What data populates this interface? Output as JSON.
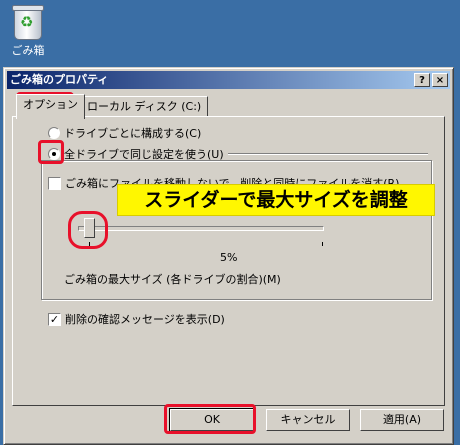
{
  "desktop": {
    "icon_label": "ごみ箱",
    "icon": "recycle-bin-icon"
  },
  "window": {
    "title": "ごみ箱のプロパティ",
    "help_label": "?",
    "close_label": "×",
    "tabs": [
      {
        "label": "オプション",
        "active": true
      },
      {
        "label": "ローカル ディスク (C:)",
        "active": false
      }
    ]
  },
  "options": {
    "radio_each_drive": {
      "label": "ドライブごとに構成する(C)",
      "selected": false
    },
    "radio_all_drives": {
      "label": "全ドライブで同じ設定を使う(U)",
      "selected": true
    },
    "checkbox_delete_immediately": {
      "label": "ごみ箱にファイルを移動しないで、削除と同時にファイルを消す(R)",
      "checked": false
    },
    "slider": {
      "value_label": "5%",
      "value_percent": 5,
      "caption": "ごみ箱の最大サイズ (各ドライブの割合)(M)"
    },
    "checkbox_confirm": {
      "label": "削除の確認メッセージを表示(D)",
      "checked": true
    }
  },
  "buttons": {
    "ok": "OK",
    "cancel": "キャンセル",
    "apply": "適用(A)"
  },
  "annotation": {
    "callout_text": "スライダーで最大サイズを調整",
    "highlight_color": "#e8102a",
    "callout_color": "#fff700"
  }
}
